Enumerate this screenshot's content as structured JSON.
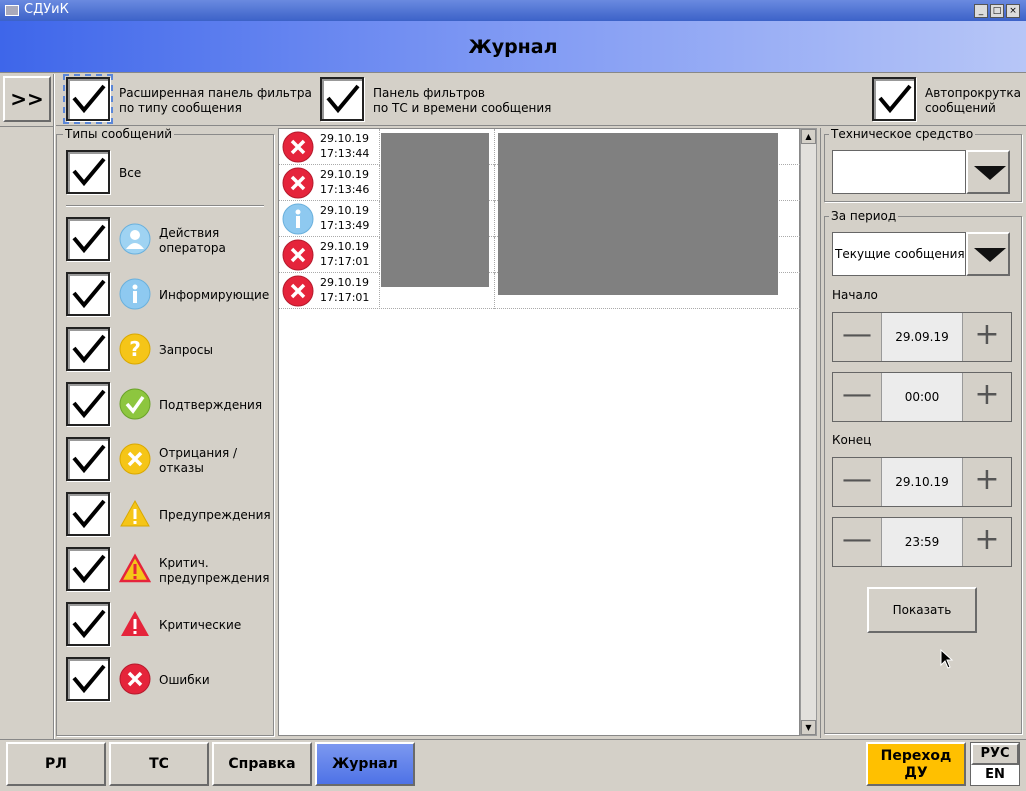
{
  "window": {
    "title": "СДУиК",
    "minimize": "_",
    "maximize": "□",
    "close": "×"
  },
  "header": {
    "title": "Журнал"
  },
  "toolbar": {
    "expand_button": ">>",
    "ext_filter_label_1": "Расширенная панель фильтра",
    "ext_filter_label_2": "по типу сообщения",
    "ts_filter_label_1": "Панель фильтров",
    "ts_filter_label_2": "по ТС и времени сообщения",
    "autoscroll_label_1": "Автопрокрутка",
    "autoscroll_label_2": "сообщений"
  },
  "types": {
    "title": "Типы сообщений",
    "all_label": "Все",
    "items": [
      {
        "l1": "Действия",
        "l2": "оператора",
        "icon": "operator-icon"
      },
      {
        "l1": "Информирующие",
        "l2": "",
        "icon": "info-icon"
      },
      {
        "l1": "Запросы",
        "l2": "",
        "icon": "question-icon"
      },
      {
        "l1": "Подтверждения",
        "l2": "",
        "icon": "confirm-icon"
      },
      {
        "l1": "Отрицания /",
        "l2": "отказы",
        "icon": "deny-icon"
      },
      {
        "l1": "Предупреждения",
        "l2": "",
        "icon": "warning-icon"
      },
      {
        "l1": "Критич.",
        "l2": "предупреждения",
        "icon": "critical-warning-icon"
      },
      {
        "l1": "Критические",
        "l2": "",
        "icon": "critical-icon"
      },
      {
        "l1": "Ошибки",
        "l2": "",
        "icon": "error-icon"
      }
    ]
  },
  "log": {
    "rows": [
      {
        "date": "29.10.19",
        "time": "17:13:44",
        "type": "error"
      },
      {
        "date": "29.10.19",
        "time": "17:13:46",
        "type": "error"
      },
      {
        "date": "29.10.19",
        "time": "17:13:49",
        "type": "info"
      },
      {
        "date": "29.10.19",
        "time": "17:17:01",
        "type": "error"
      },
      {
        "date": "29.10.19",
        "time": "17:17:01",
        "type": "error"
      }
    ]
  },
  "filters": {
    "device_title": "Техническое средство",
    "device_value": "",
    "period_title": "За период",
    "period_value": "Текущие сообщения",
    "start_label": "Начало",
    "start_date": "29.09.19",
    "start_time": "00:00",
    "end_label": "Конец",
    "end_date": "29.10.19",
    "end_time": "23:59",
    "minus": "—",
    "plus": "+",
    "show_button": "Показать"
  },
  "bottom": {
    "tabs": [
      "РЛ",
      "ТС",
      "Справка",
      "Журнал"
    ],
    "active_tab": "Журнал",
    "du_1": "Переход",
    "du_2": "ДУ",
    "lang_ru": "РУС",
    "lang_en": "EN"
  },
  "colors": {
    "accent": "#3e66ea",
    "error": "#e5243b",
    "info": "#8ec9f0",
    "du": "#ffc000"
  }
}
